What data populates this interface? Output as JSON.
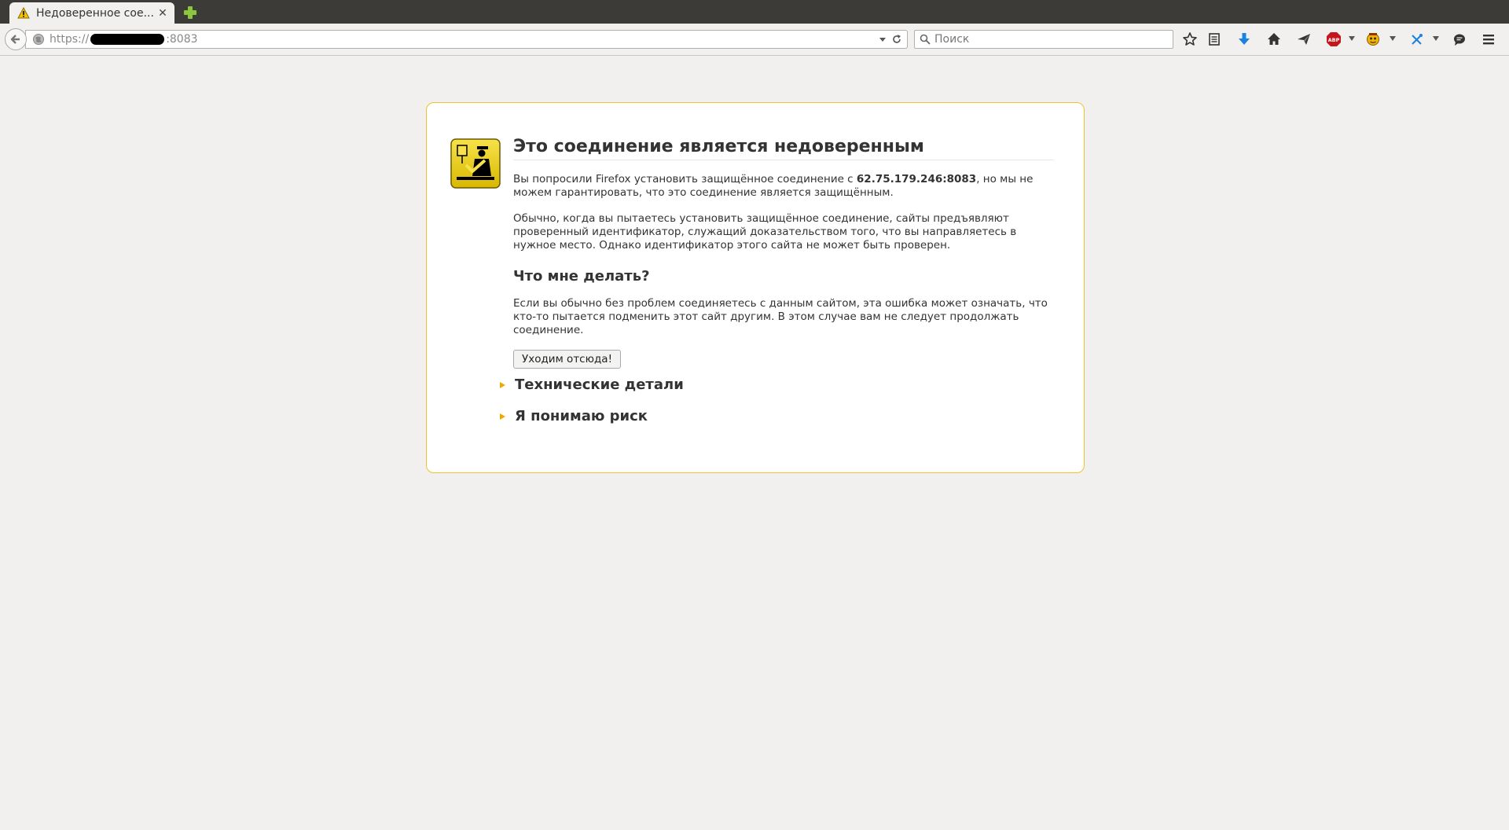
{
  "tab": {
    "title": "Недоверенное сое...",
    "close": "✕"
  },
  "urlbar": {
    "scheme": "https://",
    "port": ":8083"
  },
  "search": {
    "placeholder": "Поиск"
  },
  "toolbar": {
    "icons": [
      "bookmark-star-icon",
      "reading-list-icon",
      "download-icon",
      "home-icon",
      "send-icon",
      "adblock-icon",
      "addon-face-icon",
      "addon-x-icon",
      "chat-icon",
      "menu-icon"
    ],
    "adblock_label": "ABP"
  },
  "error": {
    "title": "Это соединение является недоверенным",
    "intro_pre": "Вы попросили Firefox установить защищённое соединение с ",
    "intro_host": "62.75.179.246:8083",
    "intro_post": ", но мы не можем гарантировать, что это соединение является защищённым.",
    "para2": "Обычно, когда вы пытаетесь установить защищённое соединение, сайты предъявляют проверенный идентификатор, служащий доказательством того, что вы направляетесь в нужное место. Однако идентификатор этого сайта не может быть проверен.",
    "whatdo_heading": "Что мне делать?",
    "para3": "Если вы обычно без проблем соединяетесь с данным сайтом, эта ошибка может означать, что кто-то пытается подменить этот сайт другим. В этом случае вам не следует продолжать соединение.",
    "getme_button": "Уходим отсюда!",
    "tech_details": "Технические детали",
    "understand_risks": "Я понимаю риск"
  },
  "colors": {
    "accent_border": "#f0c12c",
    "icon_yellow": "#e9c400",
    "download_blue": "#1a82e2",
    "adblock_red": "#c5161d"
  }
}
